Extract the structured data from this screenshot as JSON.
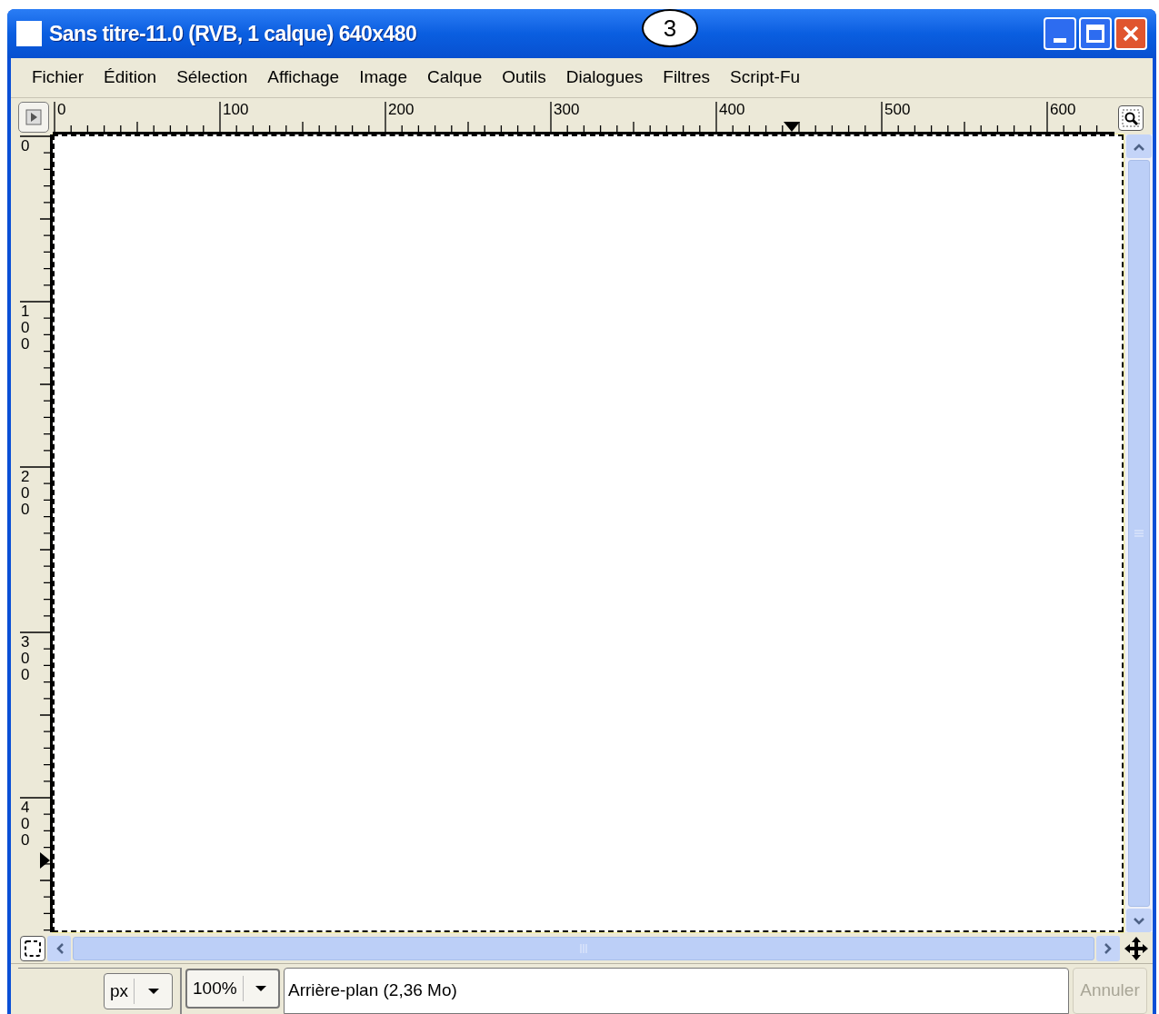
{
  "window": {
    "title": "Sans titre-11.0 (RVB, 1 calque) 640x480"
  },
  "callout": {
    "label": "3"
  },
  "menu": [
    "Fichier",
    "Édition",
    "Sélection",
    "Affichage",
    "Image",
    "Calque",
    "Outils",
    "Dialogues",
    "Filtres",
    "Script-Fu"
  ],
  "rulers": {
    "horizontal": [
      "0",
      "100",
      "200",
      "300",
      "400",
      "500",
      "600"
    ],
    "vertical": [
      "0",
      "100",
      "200",
      "300",
      "400"
    ]
  },
  "status_bar": {
    "unit": "px",
    "zoom": "100%",
    "message": "Arrière-plan (2,36 Mo)",
    "cancel": {
      "label": "Annuler",
      "disabled": true
    }
  }
}
